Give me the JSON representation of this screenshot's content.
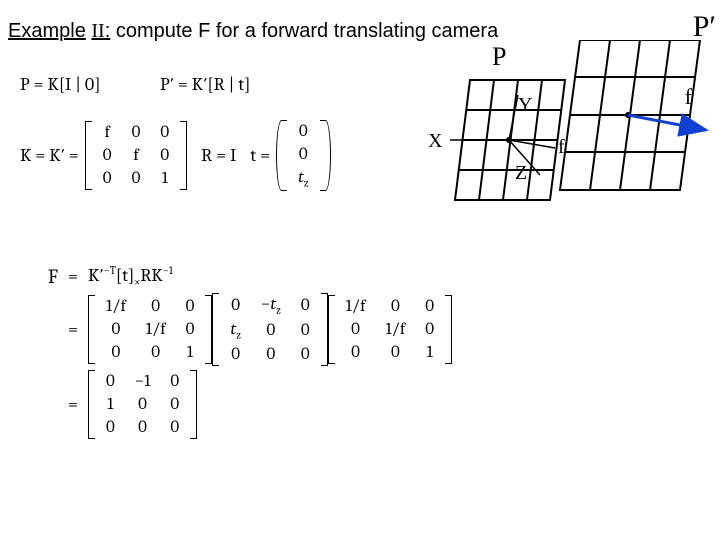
{
  "title": {
    "example": "Example",
    "roman": "II",
    "colon": ":",
    "rest": "compute F for a forward translating camera"
  },
  "line1": {
    "P_eq": "P = K[I | 0]",
    "Pp_eq": "P′ = K′[R | t]"
  },
  "KK": {
    "lhs": "K = K′ =",
    "m": [
      [
        "f",
        "0",
        "0"
      ],
      [
        "0",
        "f",
        "0"
      ],
      [
        "0",
        "0",
        "1"
      ]
    ],
    "Rlhs": "R = I",
    "tlhs": "t =",
    "t": [
      [
        "0"
      ],
      [
        "0"
      ],
      [
        "t_z"
      ]
    ]
  },
  "F": {
    "lhs1": "F",
    "eq1": "=",
    "rhs1": "K′⁻ᵀ [t]ₓ R K⁻¹",
    "eq2": "=",
    "m1": [
      [
        "1/f",
        "0",
        "0"
      ],
      [
        "0",
        "1/f",
        "0"
      ],
      [
        "0",
        "0",
        "1"
      ]
    ],
    "m2": [
      [
        "0",
        "−t_z",
        "0"
      ],
      [
        "t_z",
        "0",
        "0"
      ],
      [
        "0",
        "0",
        "0"
      ]
    ],
    "m3": [
      [
        "1/f",
        "0",
        "0"
      ],
      [
        "0",
        "1/f",
        "0"
      ],
      [
        "0",
        "0",
        "1"
      ]
    ],
    "eq3": "=",
    "m4": [
      [
        "0",
        "−1",
        "0"
      ],
      [
        "1",
        "0",
        "0"
      ],
      [
        "0",
        "0",
        "0"
      ]
    ]
  },
  "diagram": {
    "P": "P",
    "Pp": "P′",
    "X": "X",
    "Y": "Y",
    "Z": "Z",
    "f1": "f",
    "f2": "f"
  }
}
